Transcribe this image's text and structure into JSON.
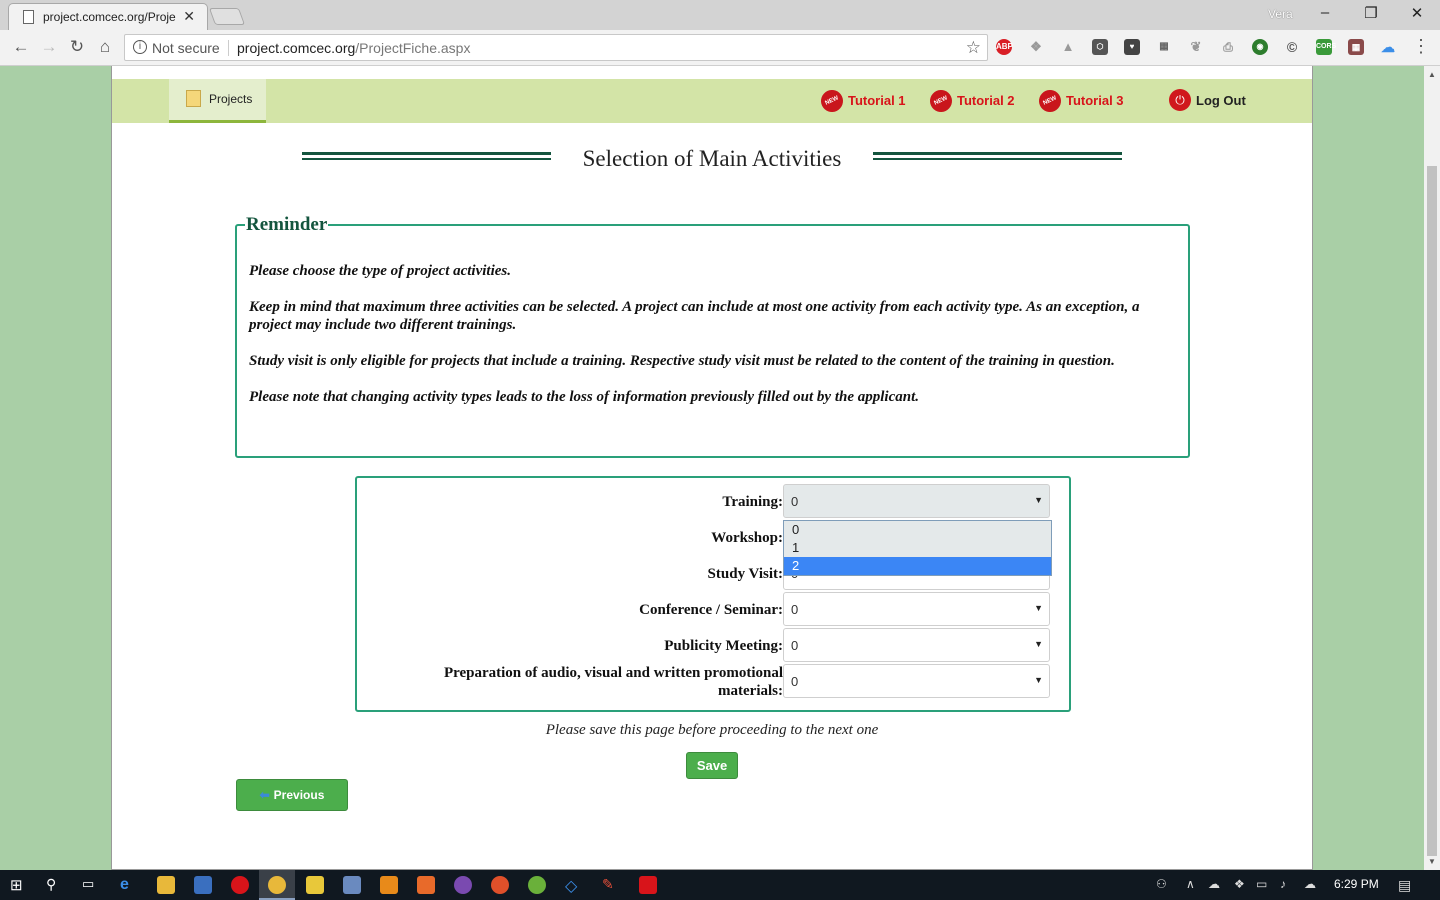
{
  "browser": {
    "tab_title": "project.comcec.org/Proje",
    "user_name": "Vera",
    "security_label": "Not secure",
    "url_host": "project.comcec.org",
    "url_path": "/ProjectFiche.aspx",
    "extensions": [
      "abp",
      "dropbox",
      "drive",
      "lock",
      "pocket",
      "qr",
      "tree",
      "pdf",
      "globe",
      "c-icon",
      "cors",
      "grid",
      "cloud"
    ]
  },
  "nav": {
    "projects_label": "Projects",
    "tutorials": [
      "Tutorial 1",
      "Tutorial 2",
      "Tutorial 3"
    ],
    "new_badge": "NEW",
    "logout_label": "Log Out"
  },
  "page": {
    "title": "Selection of Main Activities",
    "reminder": {
      "legend": "Reminder",
      "paragraphs": [
        "Please choose the type of project activities.",
        "Keep in mind that maximum three activities can be selected. A project can include at most one activity from each activity type. As an exception, a project may include two different trainings.",
        "Study visit is only eligible for projects that include a training. Respective study visit must be related to the content of the training in question.",
        "Please note that changing activity types leads to the loss of information previously filled out by the applicant."
      ]
    },
    "form": {
      "fields": [
        {
          "label": "Training:",
          "value": "0"
        },
        {
          "label": "Workshop:",
          "value": "0"
        },
        {
          "label": "Study Visit:",
          "value": "0"
        },
        {
          "label": "Conference / Seminar:",
          "value": "0"
        },
        {
          "label": "Publicity Meeting:",
          "value": "0"
        },
        {
          "label": "Preparation of audio, visual and written promotional materials:",
          "value": "0"
        }
      ],
      "open_dropdown": {
        "options": [
          "0",
          "1",
          "2"
        ],
        "highlighted": "2"
      }
    },
    "save_note": "Please save this page before proceeding to the next one",
    "save_label": "Save",
    "previous_label": "Previous"
  },
  "taskbar": {
    "clock": "6:29 PM"
  },
  "colors": {
    "accent_green": "#2aa07a",
    "heading_green": "#14553e",
    "nav_bg": "#d3e4a7",
    "button_green": "#4cae4c",
    "tutorial_red": "#d8141a",
    "highlight_blue": "#3b86f5"
  }
}
